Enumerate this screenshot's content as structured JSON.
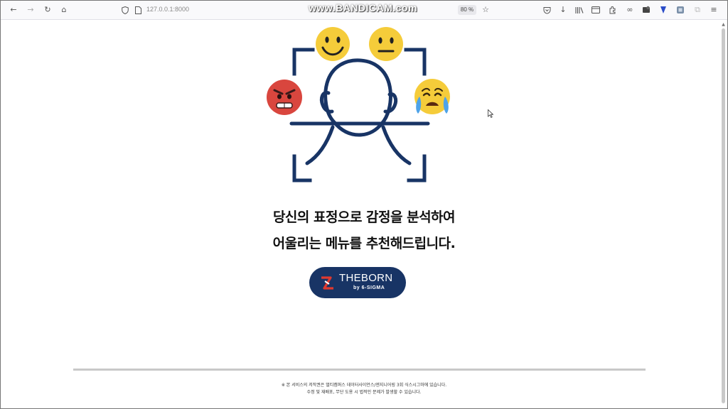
{
  "browser": {
    "url": "127.0.0.1:8000",
    "zoom": "80 %",
    "watermark": "www.BANDICAM.com"
  },
  "hero": {
    "faces": [
      "smiling-face",
      "neutral-face",
      "angry-face",
      "crying-face"
    ]
  },
  "headline": {
    "line1": "당신의 표정으로 감정을 분석하여",
    "line2": "어울리는 메뉴를 추천해드립니다."
  },
  "logo": {
    "name": "THEBORN",
    "sub": "by 6-SIGMA",
    "color": "#183465"
  },
  "footer": {
    "line1": "※ 본 서비스의 저작권은 멀티캠퍼스 데이터사이언스/엔지니어링 3회 식스시그마에 있습니다.",
    "line2": "수정 및 재배포, 무단 도용 시 법적인 문제가 발생할 수 있습니다."
  },
  "colors": {
    "navy": "#183465",
    "emoji_yellow": "#f5cc3a",
    "angry_red": "#d9463e"
  }
}
